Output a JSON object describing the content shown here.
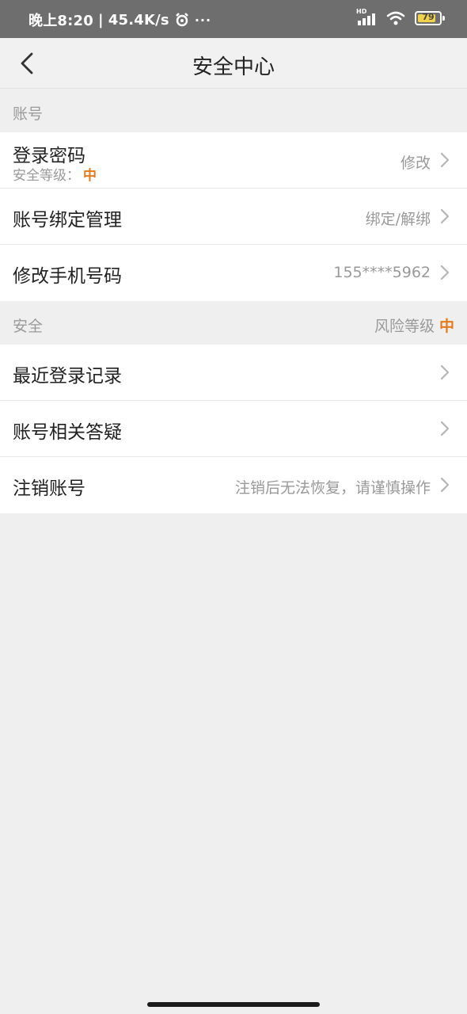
{
  "status_bar": {
    "time": "晚上8:20",
    "speed": "45.4K/s",
    "dots": "···",
    "hd_label": "HD",
    "battery_level": "79"
  },
  "nav": {
    "title": "安全中心",
    "back_icon": "chevron-left-icon"
  },
  "account_section": {
    "label": "账号",
    "items": [
      {
        "title": "登录密码",
        "subtitle_label": "安全等级：",
        "subtitle_level": "中",
        "value": "修改"
      },
      {
        "title": "账号绑定管理",
        "value": "绑定/解绑"
      },
      {
        "title": "修改手机号码",
        "value": "155****5962"
      }
    ]
  },
  "security_section": {
    "label": "安全",
    "risk_label": "风险等级",
    "risk_level": "中",
    "items": [
      {
        "title": "最近登录记录",
        "value": ""
      },
      {
        "title": "账号相关答疑",
        "value": ""
      },
      {
        "title": "注销账号",
        "value": "注销后无法恢复，请谨慎操作"
      }
    ]
  },
  "colors": {
    "accent": "#e67a1c",
    "status_bar": "#6e6e6e",
    "background": "#efefef"
  }
}
